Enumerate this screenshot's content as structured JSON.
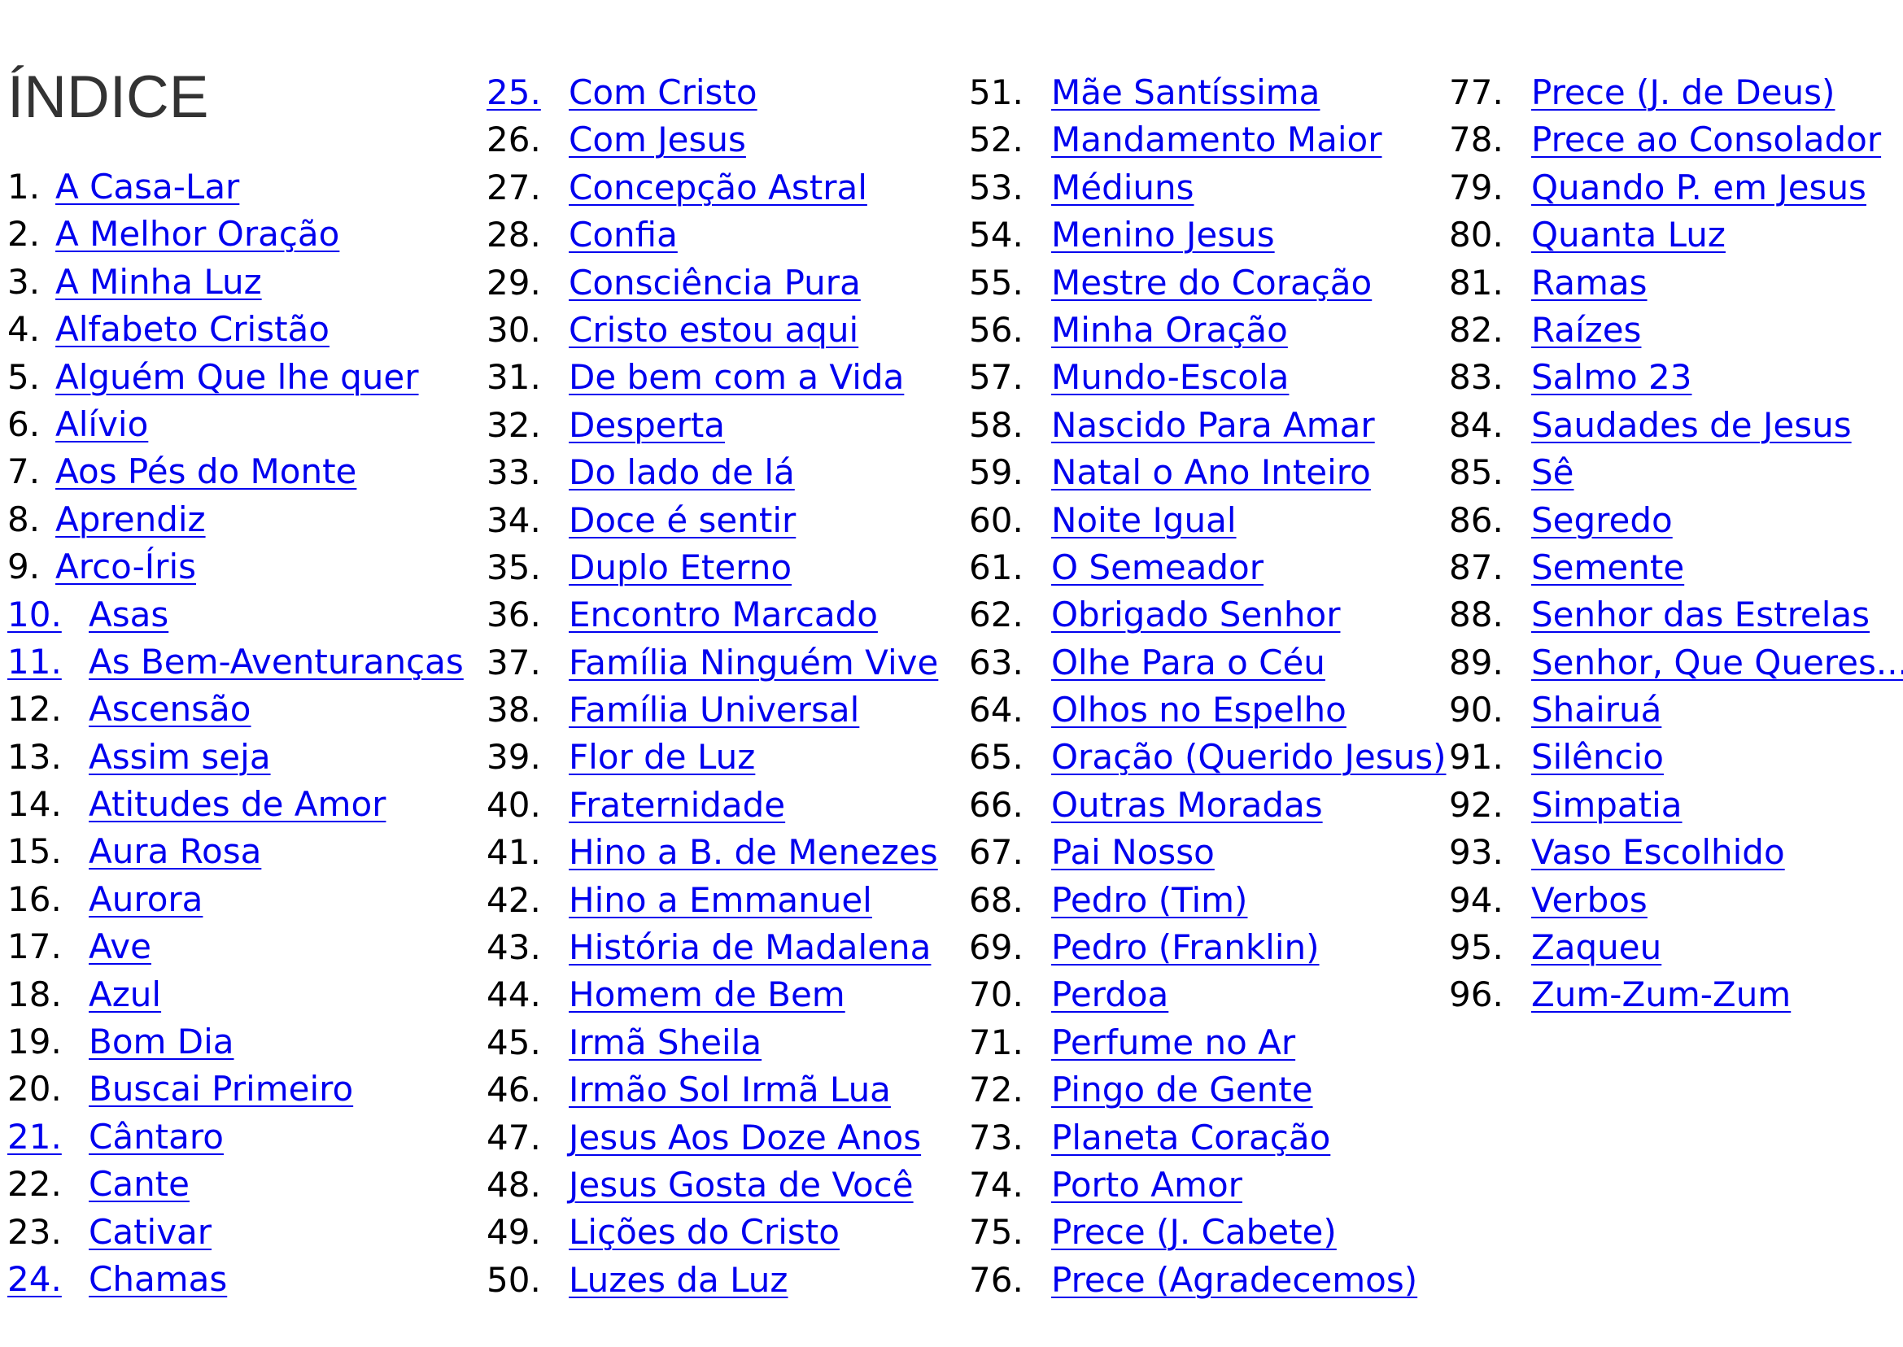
{
  "title": "ÍNDICE",
  "colors": {
    "link": "#0000ee",
    "text": "#000000",
    "title": "#333333"
  },
  "col1": [
    {
      "n": "1.",
      "label": "A Casa-Lar"
    },
    {
      "n": "2.",
      "label": "A Melhor Oração"
    },
    {
      "n": "3.",
      "label": "A Minha Luz"
    },
    {
      "n": "4.",
      "label": "Alfabeto Cristão"
    },
    {
      "n": "5.",
      "label": "Alguém Que lhe quer"
    },
    {
      "n": "6.",
      "label": "Alívio"
    },
    {
      "n": "7.",
      "label": "Aos Pés do Monte"
    },
    {
      "n": "8.",
      "label": "Aprendiz"
    },
    {
      "n": "9.",
      "label": "Arco-Íris"
    },
    {
      "n": "10.",
      "label": "Asas"
    },
    {
      "n": "11.",
      "label": "As Bem-Aventuranças"
    },
    {
      "n": "12.",
      "label": "Ascensão"
    },
    {
      "n": "13.",
      "label": "Assim seja"
    },
    {
      "n": "14.",
      "label": "Atitudes de Amor"
    },
    {
      "n": "15.",
      "label": "Aura Rosa"
    },
    {
      "n": "16.",
      "label": "Aurora"
    },
    {
      "n": "17.",
      "label": "Ave"
    },
    {
      "n": "18.",
      "label": "Azul"
    },
    {
      "n": "19.",
      "label": "Bom Dia"
    },
    {
      "n": "20.",
      "label": "Buscai Primeiro"
    },
    {
      "n": "21.",
      "label": "Cântaro"
    },
    {
      "n": "22.",
      "label": "Cante"
    },
    {
      "n": "23.",
      "label": "Cativar"
    },
    {
      "n": "24.",
      "label": "Chamas"
    }
  ],
  "col2": [
    {
      "n": "25.",
      "label": "Com Cristo"
    },
    {
      "n": "26.",
      "label": "Com Jesus"
    },
    {
      "n": "27.",
      "label": "Concepção Astral"
    },
    {
      "n": "28.",
      "label": "Confia"
    },
    {
      "n": "29.",
      "label": "Consciência Pura"
    },
    {
      "n": "30.",
      "label": "Cristo estou aqui"
    },
    {
      "n": "31.",
      "label": "De bem com a Vida"
    },
    {
      "n": "32.",
      "label": "Desperta"
    },
    {
      "n": "33.",
      "label": "Do lado de lá"
    },
    {
      "n": "34.",
      "label": "Doce é sentir"
    },
    {
      "n": "35.",
      "label": "Duplo Eterno"
    },
    {
      "n": "36.",
      "label": "Encontro Marcado"
    },
    {
      "n": "37.",
      "label": "Família Ninguém Vive"
    },
    {
      "n": "38.",
      "label": "Família Universal"
    },
    {
      "n": "39.",
      "label": "Flor de Luz"
    },
    {
      "n": "40.",
      "label": "Fraternidade"
    },
    {
      "n": "41.",
      "label": "Hino a B. de Menezes"
    },
    {
      "n": "42.",
      "label": "Hino a Emmanuel"
    },
    {
      "n": "43.",
      "label": "História de Madalena"
    },
    {
      "n": "44.",
      "label": "Homem de Bem"
    },
    {
      "n": "45.",
      "label": "Irmã Sheila"
    },
    {
      "n": "46.",
      "label": "Irmão Sol Irmã Lua"
    },
    {
      "n": "47.",
      "label": "Jesus Aos Doze Anos"
    },
    {
      "n": "48.",
      "label": "Jesus Gosta de Você"
    },
    {
      "n": "49.",
      "label": "Lições do Cristo"
    },
    {
      "n": "50.",
      "label": "Luzes da Luz"
    }
  ],
  "col3": [
    {
      "n": "51.",
      "label": "Mãe Santíssima"
    },
    {
      "n": "52.",
      "label": "Mandamento Maior"
    },
    {
      "n": "53.",
      "label": "Médiuns"
    },
    {
      "n": "54.",
      "label": "Menino Jesus"
    },
    {
      "n": "55.",
      "label": "Mestre do Coração"
    },
    {
      "n": "56.",
      "label": "Minha Oração"
    },
    {
      "n": "57.",
      "label": "Mundo-Escola"
    },
    {
      "n": "58.",
      "label": "Nascido Para Amar"
    },
    {
      "n": "59.",
      "label": "Natal o Ano Inteiro"
    },
    {
      "n": "60.",
      "label": "Noite Igual"
    },
    {
      "n": "61.",
      "label": "O Semeador"
    },
    {
      "n": "62.",
      "label": "Obrigado Senhor"
    },
    {
      "n": "63.",
      "label": "Olhe Para o Céu"
    },
    {
      "n": "64.",
      "label": "Olhos no Espelho"
    },
    {
      "n": "65.",
      "label": "Oração (Querido Jesus)"
    },
    {
      "n": "66.",
      "label": "Outras Moradas"
    },
    {
      "n": "67.",
      "label": "Pai Nosso"
    },
    {
      "n": "68.",
      "label": "Pedro (Tim)"
    },
    {
      "n": "69.",
      "label": "Pedro (Franklin)"
    },
    {
      "n": "70.",
      "label": "Perdoa"
    },
    {
      "n": "71.",
      "label": "Perfume no Ar"
    },
    {
      "n": "72.",
      "label": "Pingo de Gente"
    },
    {
      "n": "73.",
      "label": "Planeta Coração"
    },
    {
      "n": "74.",
      "label": "Porto Amor"
    },
    {
      "n": "75.",
      "label": "Prece (J. Cabete)"
    },
    {
      "n": "76.",
      "label": "Prece (Agradecemos)"
    }
  ],
  "col4": [
    {
      "n": "77.",
      "label": "Prece (J. de Deus)"
    },
    {
      "n": "78.",
      "label": "Prece ao Consolador"
    },
    {
      "n": "79.",
      "label": "Quando P. em Jesus"
    },
    {
      "n": "80.",
      "label": "Quanta Luz"
    },
    {
      "n": "81.",
      "label": "Ramas"
    },
    {
      "n": "82.",
      "label": "Raízes"
    },
    {
      "n": "83.",
      "label": "Salmo 23"
    },
    {
      "n": "84.",
      "label": "Saudades de Jesus"
    },
    {
      "n": "85.",
      "label": "Sê"
    },
    {
      "n": "86.",
      "label": "Segredo"
    },
    {
      "n": "87.",
      "label": "Semente"
    },
    {
      "n": "88.",
      "label": "Senhor das Estrelas"
    },
    {
      "n": "89.",
      "label": "Senhor, Que Queres..."
    },
    {
      "n": "90.",
      "label": "Shairuá"
    },
    {
      "n": "91.",
      "label": "Silêncio"
    },
    {
      "n": "92.",
      "label": "Simpatia"
    },
    {
      "n": "93.",
      "label": "Vaso Escolhido"
    },
    {
      "n": "94.",
      "label": "Verbos"
    },
    {
      "n": "95.",
      "label": "Zaqueu"
    },
    {
      "n": "96.",
      "label": "Zum-Zum-Zum"
    }
  ]
}
